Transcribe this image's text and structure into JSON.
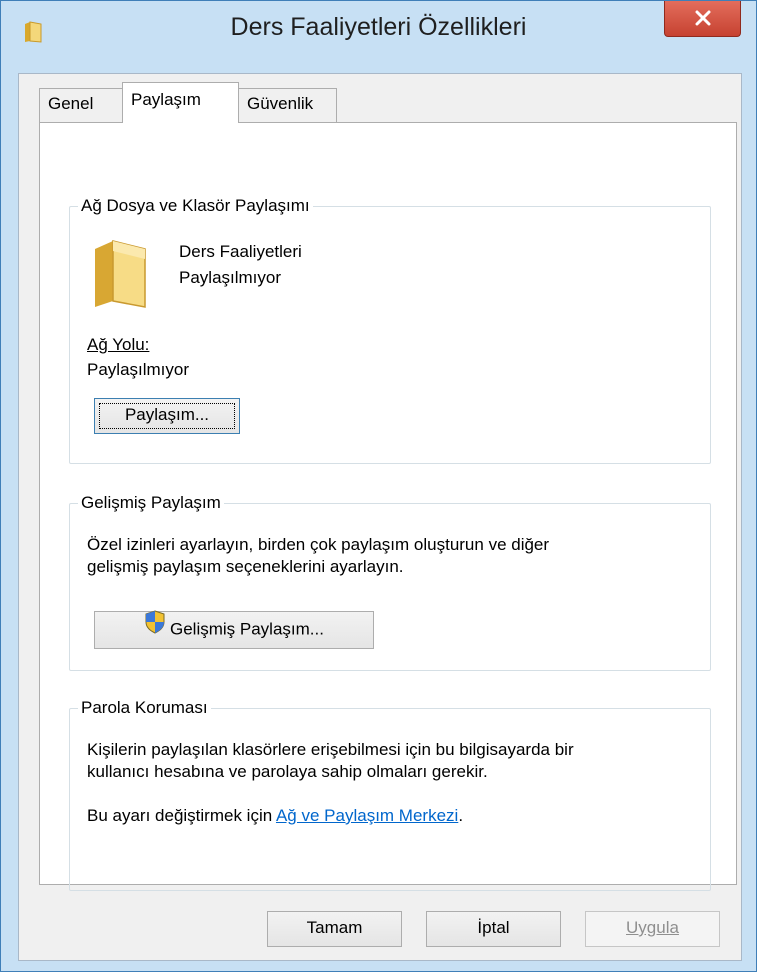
{
  "window": {
    "title": "Ders Faaliyetleri Özellikleri"
  },
  "tabs": [
    {
      "label": "Genel"
    },
    {
      "label": "Paylaşım"
    },
    {
      "label": "Güvenlik"
    }
  ],
  "network_sharing": {
    "group_title": "Ağ Dosya ve Klasör Paylaşımı",
    "folder_name": "Ders Faaliyetleri",
    "folder_status": "Paylaşılmıyor",
    "path_label": "Ağ Yolu:",
    "path_value": "Paylaşılmıyor",
    "share_button": "Paylaşım..."
  },
  "advanced_sharing": {
    "group_title": "Gelişmiş Paylaşım",
    "description_line1": "Özel izinleri ayarlayın, birden çok paylaşım oluşturun ve diğer",
    "description_line2": "gelişmiş paylaşım seçeneklerini ayarlayın.",
    "button": "Gelişmiş Paylaşım..."
  },
  "password_protection": {
    "group_title": "Parola Koruması",
    "description_line1": "Kişilerin paylaşılan klasörlere erişebilmesi için bu bilgisayarda bir",
    "description_line2": "kullanıcı hesabına ve parolaya sahip olmaları gerekir.",
    "change_prefix": "Bu ayarı değiştirmek için ",
    "link_text": "Ağ ve Paylaşım Merkezi",
    "change_suffix": "."
  },
  "footer": {
    "ok": "Tamam",
    "cancel": "İptal",
    "apply": "Uygula"
  },
  "colors": {
    "title_bar": "#c7e0f4",
    "close_button": "#c64231",
    "link": "#0066cc"
  },
  "icons": {
    "title": "folder-icon",
    "close": "close-icon",
    "folder": "folder-icon",
    "uac_shield": "shield-icon"
  }
}
